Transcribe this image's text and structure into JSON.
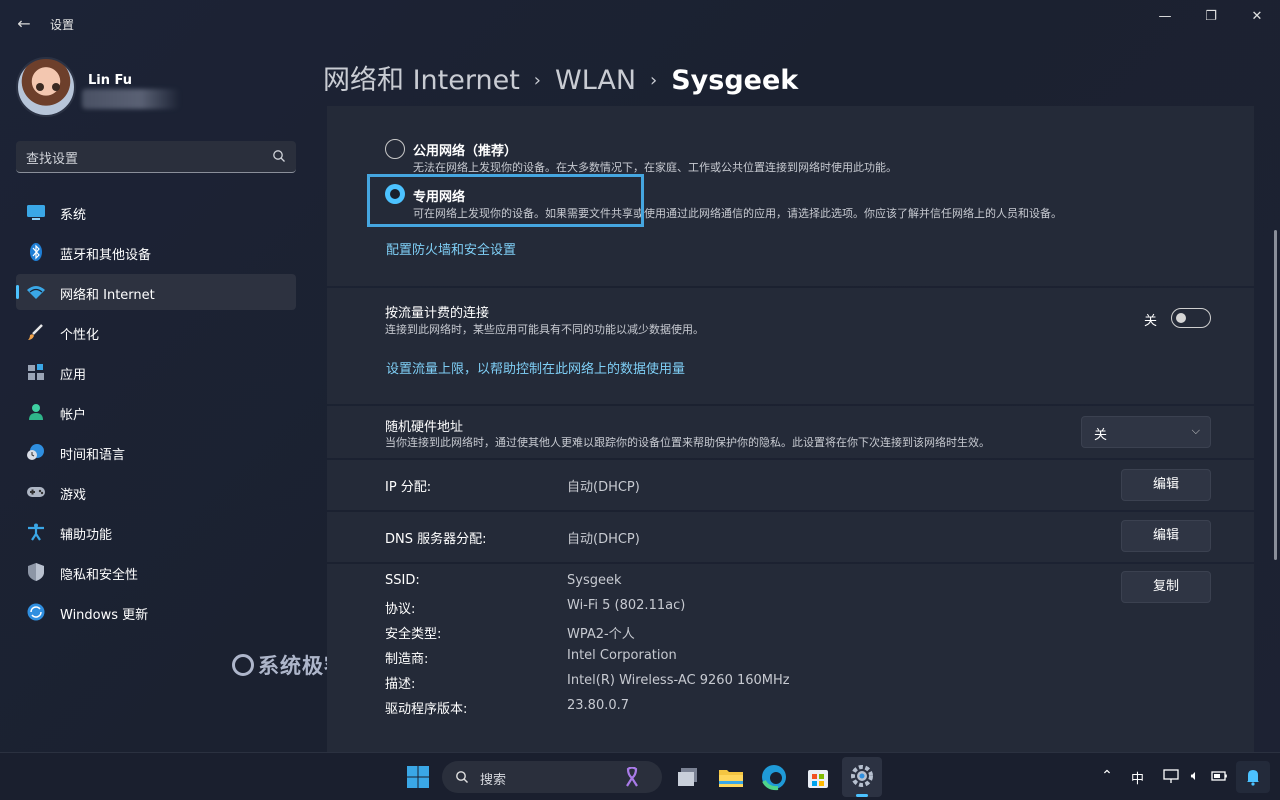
{
  "window": {
    "title": "设置",
    "back_icon": "arrow-left-icon",
    "minimize_icon": "minimize-icon",
    "maximize_icon": "restore-icon",
    "close_icon": "close-icon"
  },
  "profile": {
    "name": "Lin Fu"
  },
  "search": {
    "placeholder": "查找设置",
    "icon": "search-icon"
  },
  "sidebar": {
    "items": [
      {
        "label": "系统",
        "icon": "monitor-icon",
        "active": false
      },
      {
        "label": "蓝牙和其他设备",
        "icon": "bluetooth-icon",
        "active": false
      },
      {
        "label": "网络和 Internet",
        "icon": "wifi-icon",
        "active": true
      },
      {
        "label": "个性化",
        "icon": "brush-icon",
        "active": false
      },
      {
        "label": "应用",
        "icon": "apps-icon",
        "active": false
      },
      {
        "label": "帐户",
        "icon": "person-icon",
        "active": false
      },
      {
        "label": "时间和语言",
        "icon": "globe-clock-icon",
        "active": false
      },
      {
        "label": "游戏",
        "icon": "gamepad-icon",
        "active": false
      },
      {
        "label": "辅助功能",
        "icon": "accessibility-icon",
        "active": false
      },
      {
        "label": "隐私和安全性",
        "icon": "shield-icon",
        "active": false
      },
      {
        "label": "Windows 更新",
        "icon": "sync-icon",
        "active": false
      }
    ]
  },
  "watermark": "系统极客",
  "breadcrumb": {
    "parts": [
      "网络和 Internet",
      "WLAN"
    ],
    "current": "Sysgeek",
    "separator": "›"
  },
  "network_profile": {
    "public": {
      "title": "公用网络（推荐）",
      "description": "无法在网络上发现你的设备。在大多数情况下，在家庭、工作或公共位置连接到网络时使用此功能。",
      "selected": false
    },
    "private": {
      "title": "专用网络",
      "description": "可在网络上发现你的设备。如果需要文件共享或使用通过此网络通信的应用，请选择此选项。你应该了解并信任网络上的人员和设备。",
      "selected": true
    },
    "firewall_link": "配置防火墙和安全设置"
  },
  "metered": {
    "title": "按流量计费的连接",
    "description": "连接到此网络时，某些应用可能具有不同的功能以减少数据使用。",
    "toggle_label": "关",
    "toggle_on": false,
    "data_limit_link": "设置流量上限，以帮助控制在此网络上的数据使用量"
  },
  "random_mac": {
    "title": "随机硬件地址",
    "description": "当你连接到此网络时，通过使其他人更难以跟踪你的设备位置来帮助保护你的隐私。此设置将在你下次连接到该网络时生效。",
    "value": "关"
  },
  "ip": {
    "label": "IP 分配:",
    "value": "自动(DHCP)",
    "button": "编辑"
  },
  "dns": {
    "label": "DNS 服务器分配:",
    "value": "自动(DHCP)",
    "button": "编辑"
  },
  "properties": {
    "copy_button": "复制",
    "items": [
      {
        "label": "SSID:",
        "value": "Sysgeek"
      },
      {
        "label": "协议:",
        "value": "Wi-Fi 5 (802.11ac)"
      },
      {
        "label": "安全类型:",
        "value": "WPA2-个人"
      },
      {
        "label": "制造商:",
        "value": "Intel Corporation"
      },
      {
        "label": "描述:",
        "value": "Intel(R) Wireless-AC 9260 160MHz"
      },
      {
        "label": "驱动程序版本:",
        "value": "23.80.0.7"
      }
    ]
  },
  "taskbar": {
    "search_label": "搜索",
    "input_indicator": "中",
    "icons": [
      "windows-start-icon",
      "search-icon",
      "ribbon-icon",
      "task-view-icon",
      "file-explorer-icon",
      "edge-icon",
      "store-icon",
      "settings-icon"
    ],
    "tray_icons": [
      "chevron-up-icon",
      "network-icon",
      "volume-icon",
      "battery-icon",
      "notification-bell-icon"
    ]
  },
  "colors": {
    "accent": "#4cc2ff",
    "link": "#7fcff6",
    "highlight_box": "#45a6e0",
    "card_bg": "#242a38"
  }
}
